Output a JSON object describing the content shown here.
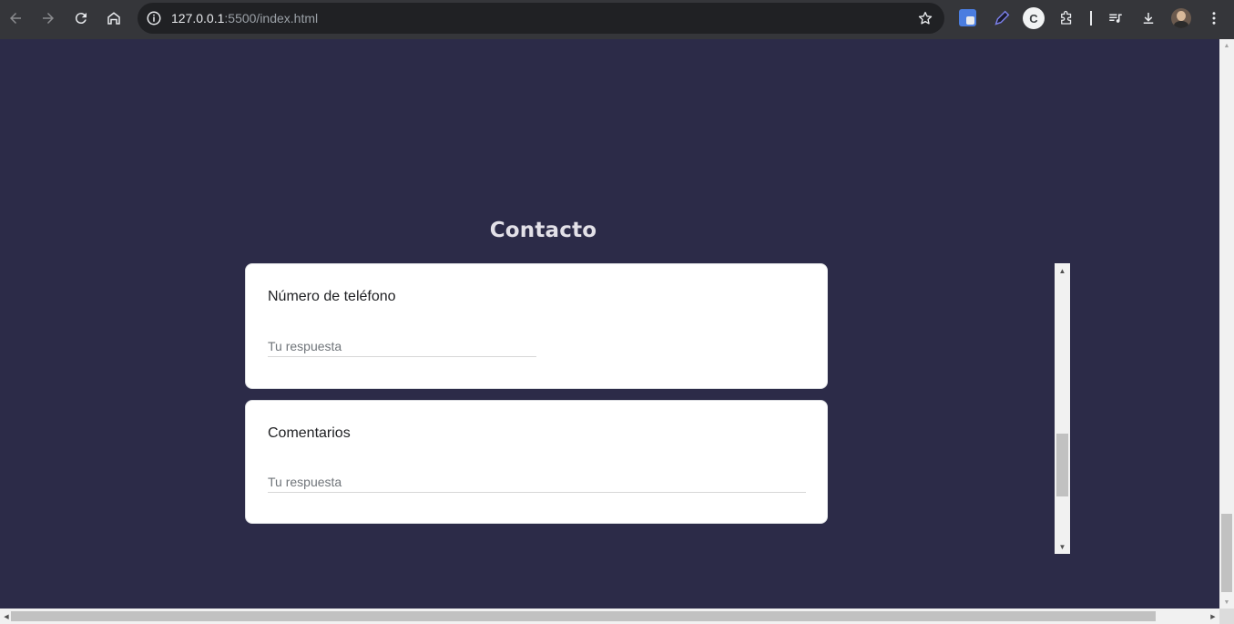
{
  "browser": {
    "url_host": "127.0.0.1",
    "url_path": ":5500/index.html",
    "extension_c_label": "C"
  },
  "contact": {
    "title": "Contacto",
    "fields": [
      {
        "label": "Número de teléfono",
        "placeholder": "Tu respuesta"
      },
      {
        "label": "Comentarios",
        "placeholder": "Tu respuesta"
      }
    ]
  },
  "icons": {
    "back": "arrow-left-icon",
    "forward": "arrow-right-icon",
    "reload": "reload-icon",
    "home": "home-icon",
    "site_info": "info-icon",
    "bookmark": "star-icon",
    "translate": "translate-icon",
    "eyedropper": "pen-icon",
    "extensions": "puzzle-icon",
    "media": "playlist-icon",
    "downloads": "download-icon",
    "menu": "more-vert-icon"
  }
}
